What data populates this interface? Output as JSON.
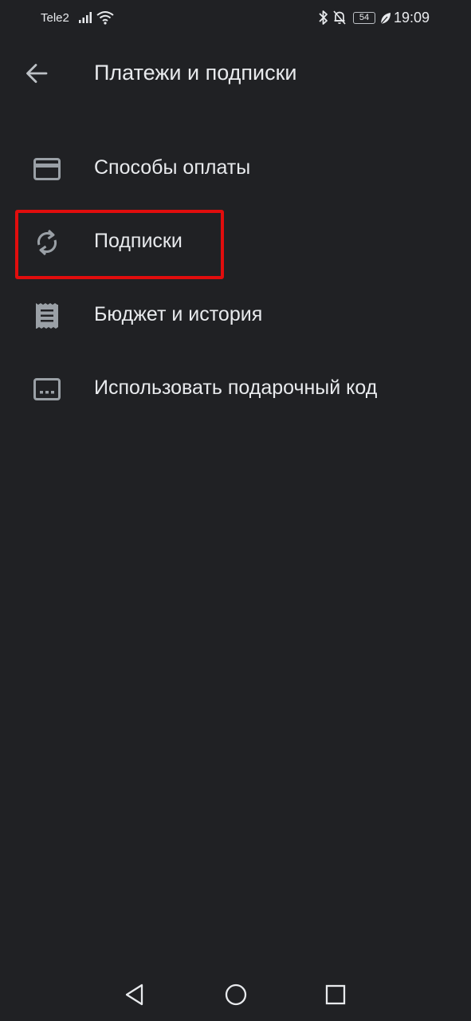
{
  "status_bar": {
    "carrier": "Tele2",
    "battery": "54",
    "time": "19:09",
    "icons": [
      "signal-icon",
      "wifi-icon",
      "bluetooth-icon",
      "mute-bell-icon",
      "battery-icon",
      "leaf-icon"
    ]
  },
  "app_bar": {
    "back_icon": "arrow-back-icon",
    "title": "Платежи и подписки"
  },
  "menu": {
    "items": [
      {
        "label": "Способы оплаты",
        "icon": "credit-card-icon"
      },
      {
        "label": "Подписки",
        "icon": "autorenew-icon",
        "highlighted": true
      },
      {
        "label": "Бюджет и история",
        "icon": "receipt-icon"
      },
      {
        "label": "Использовать подарочный код",
        "icon": "redeem-code-icon"
      }
    ]
  },
  "highlight_color": "#e10d0d",
  "nav_bar": {
    "icons": [
      "back-triangle-icon",
      "home-circle-icon",
      "recents-square-icon"
    ]
  }
}
